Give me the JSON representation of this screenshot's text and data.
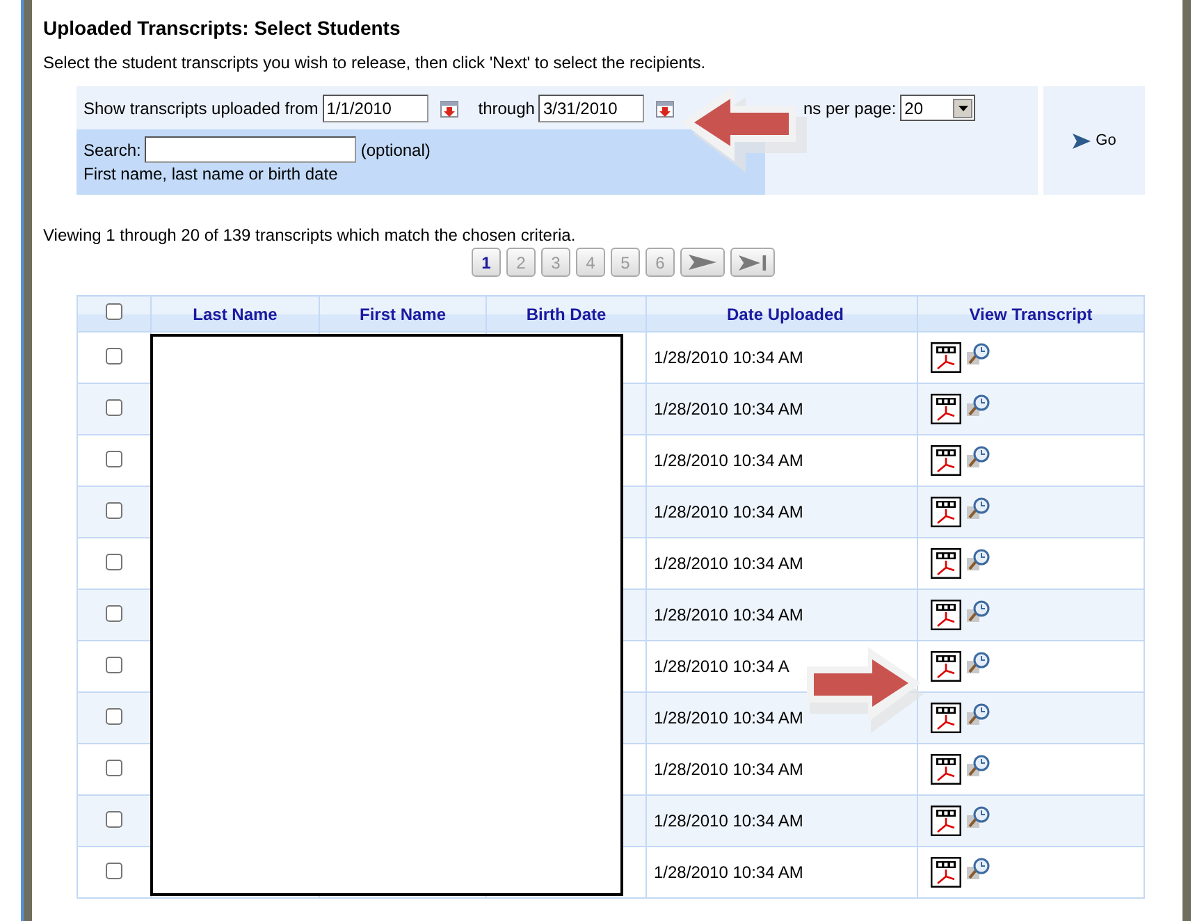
{
  "page": {
    "title": "Uploaded Transcripts: Select Students",
    "instructions": "Select the student transcripts you wish to release, then click 'Next' to select the recipients."
  },
  "filters": {
    "from_label": "Show transcripts uploaded from",
    "from_value": "1/1/2010",
    "through_label": "through",
    "through_value": "3/31/2010",
    "per_page_label": "ns per page:",
    "per_page_value": "20",
    "search_label": "Search:",
    "search_note": "(optional)",
    "search_hint": "First name, last name or birth date",
    "go_button": "Go"
  },
  "summary": "Viewing 1 through 20 of 139 transcripts which match the chosen criteria.",
  "pager": [
    {
      "label": "1",
      "selected": true
    },
    {
      "label": "2",
      "selected": false
    },
    {
      "label": "3",
      "selected": false
    },
    {
      "label": "4",
      "selected": false
    },
    {
      "label": "5",
      "selected": false
    },
    {
      "label": "6",
      "selected": false
    }
  ],
  "table": {
    "select_all_checked": false,
    "columns": [
      "Last Name",
      "First Name",
      "Birth Date",
      "Date Uploaded",
      "View Transcript"
    ],
    "rows": [
      {
        "checked": false,
        "date_uploaded": "1/28/2010 10:34 AM"
      },
      {
        "checked": false,
        "date_uploaded": "1/28/2010 10:34 AM"
      },
      {
        "checked": false,
        "date_uploaded": "1/28/2010 10:34 AM"
      },
      {
        "checked": false,
        "date_uploaded": "1/28/2010 10:34 AM"
      },
      {
        "checked": false,
        "date_uploaded": "1/28/2010 10:34 AM"
      },
      {
        "checked": false,
        "date_uploaded": "1/28/2010 10:34 AM"
      },
      {
        "checked": false,
        "date_uploaded": "1/28/2010 10:34 A"
      },
      {
        "checked": false,
        "date_uploaded": "1/28/2010 10:34 AM"
      },
      {
        "checked": false,
        "date_uploaded": "1/28/2010 10:34 AM"
      },
      {
        "checked": false,
        "date_uploaded": "1/28/2010 10:34 AM"
      },
      {
        "checked": false,
        "date_uploaded": "1/28/2010 10:34 AM"
      }
    ]
  }
}
